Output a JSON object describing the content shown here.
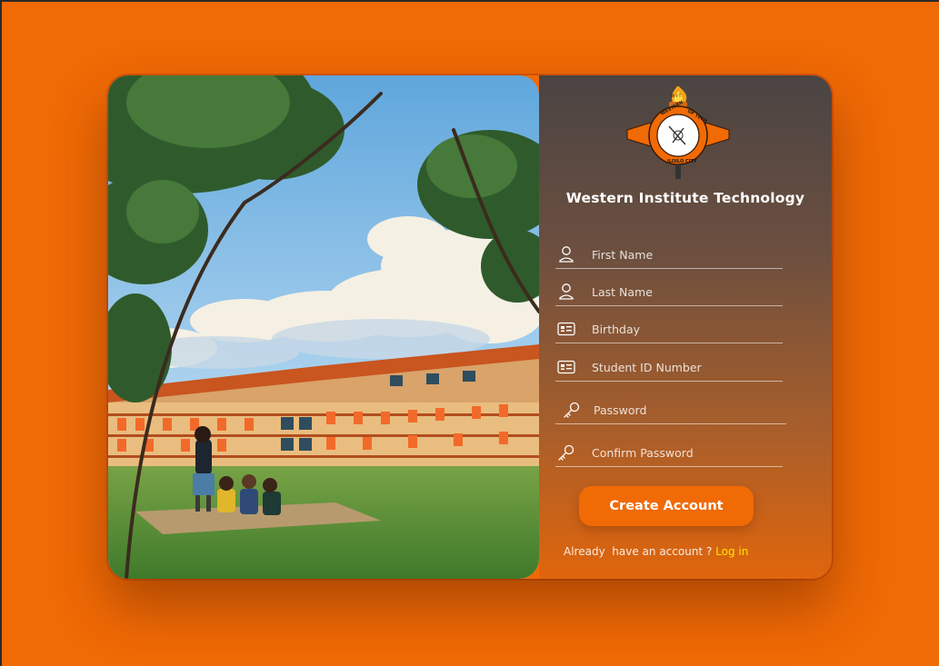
{
  "brand": {
    "name": "Western Institute Technology",
    "seal_ring_text": "WESTERN INSTITUTE OF TECHNOLOGY",
    "seal_bottom_text": "ILOILO CITY",
    "seal_top_text": "W·I·T"
  },
  "form": {
    "first_name_placeholder": "First Name",
    "last_name_placeholder": "Last Name",
    "birthday_placeholder": "Birthday",
    "student_id_placeholder": "Student ID Number",
    "password_placeholder": "Password",
    "confirm_password_placeholder": "Confirm Password",
    "submit_label": "Create Account"
  },
  "footer": {
    "prompt": "Already  have an account ? ",
    "login_link": "Log in"
  },
  "icons": {
    "first_name": "user-icon",
    "last_name": "user-icon",
    "birthday": "id-card-icon",
    "student_id": "id-card-icon",
    "password": "key-icon",
    "confirm_password": "key-icon"
  },
  "colors": {
    "background": "#f06a05",
    "button": "#f06a05",
    "link": "#ffe400"
  }
}
